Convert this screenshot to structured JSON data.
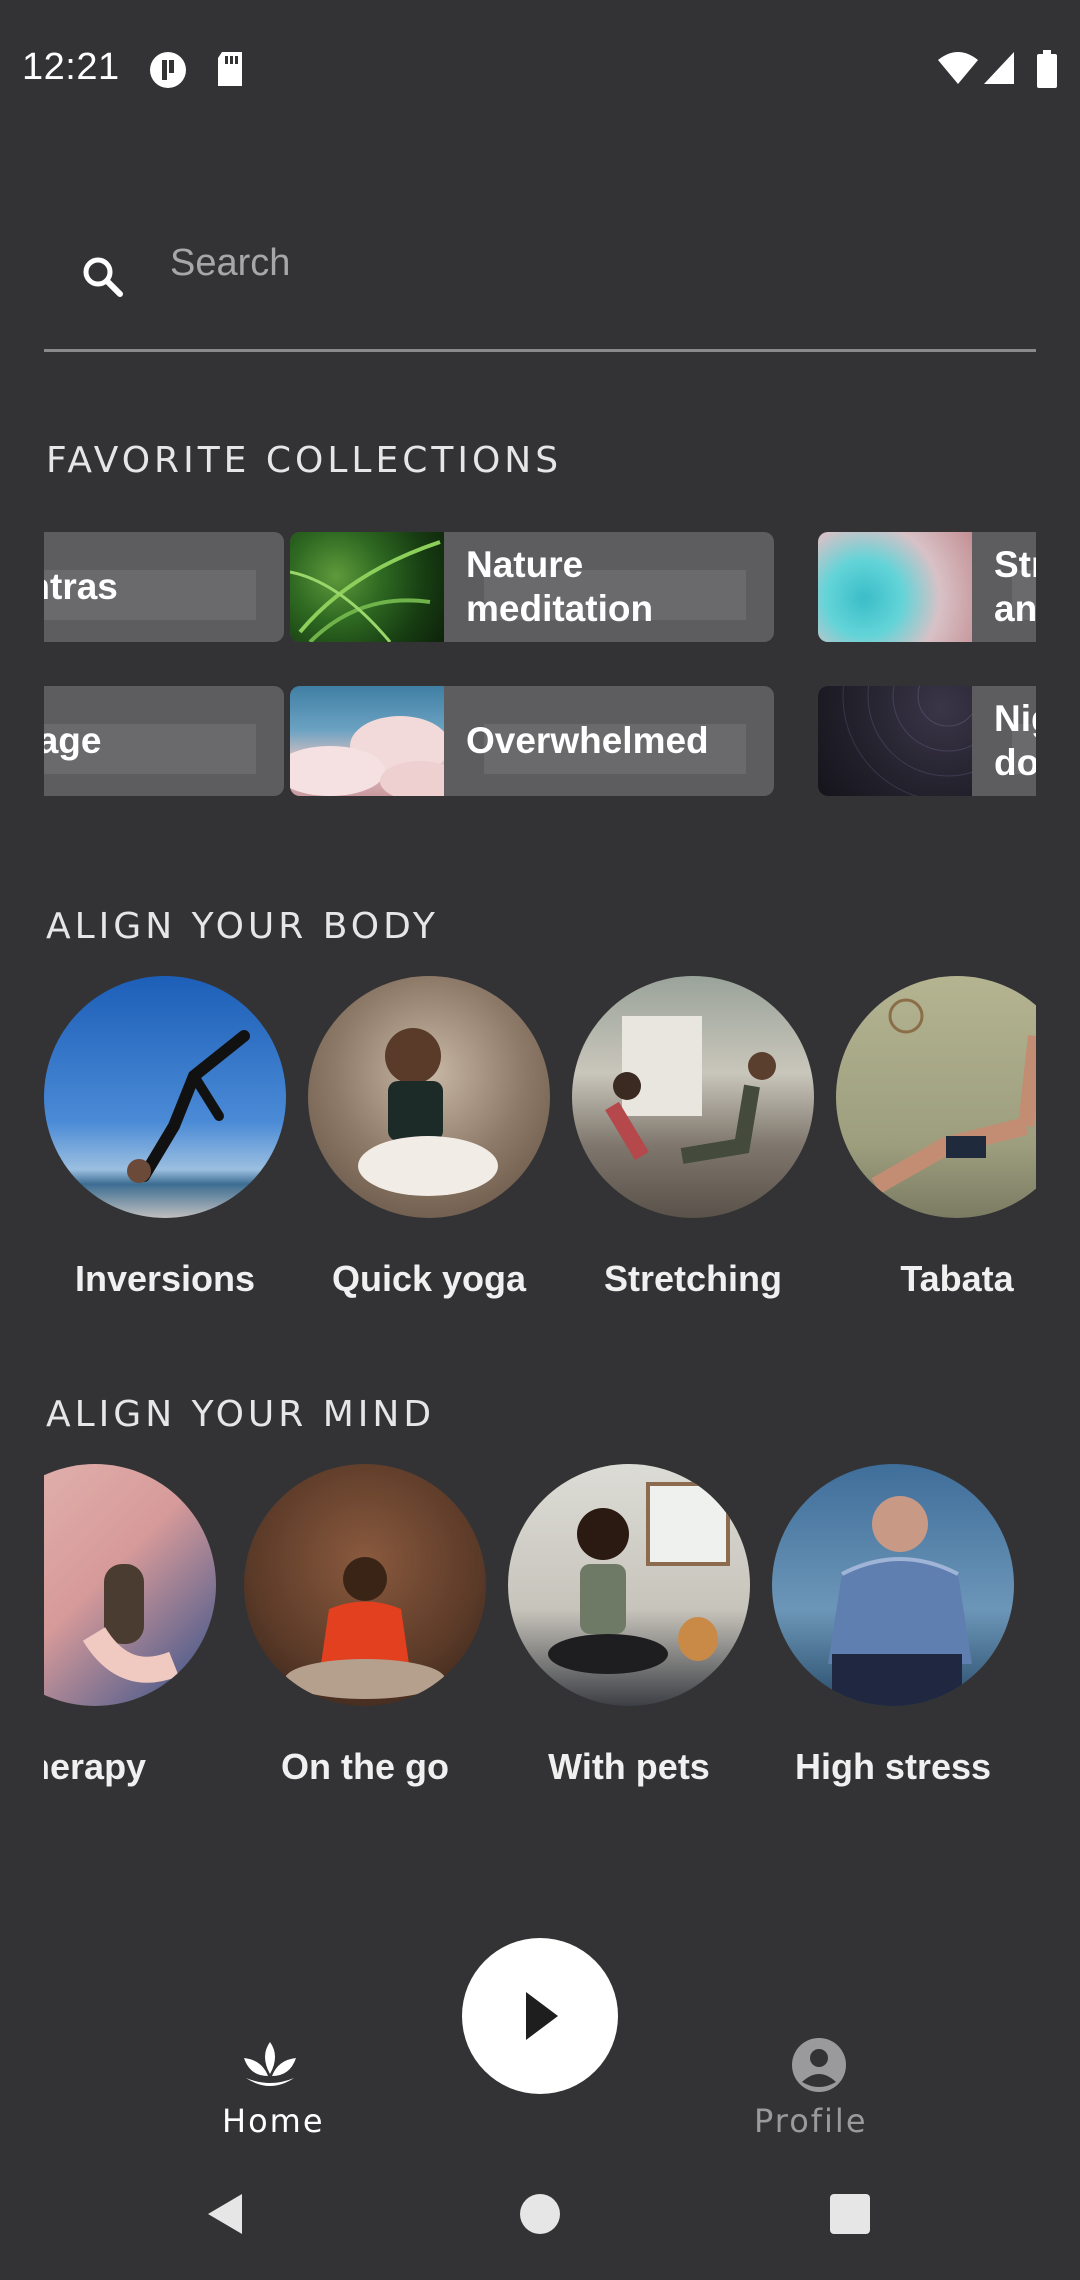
{
  "status_bar": {
    "time": "12:21"
  },
  "search": {
    "placeholder": "Search"
  },
  "favorite_collections": {
    "title": "FAVORITE COLLECTIONS",
    "items": [
      {
        "label": "Mantras"
      },
      {
        "label": "Nature meditation"
      },
      {
        "label": "Str an"
      },
      {
        "label": "assage"
      },
      {
        "label": "Overwhelmed"
      },
      {
        "label": "Nig do"
      }
    ]
  },
  "align_body": {
    "title": "ALIGN YOUR BODY",
    "items": [
      {
        "label": "Inversions"
      },
      {
        "label": "Quick yoga"
      },
      {
        "label": "Stretching"
      },
      {
        "label": "Tabata"
      }
    ]
  },
  "align_mind": {
    "title": "ALIGN YOUR MIND",
    "items": [
      {
        "label": "matherapy"
      },
      {
        "label": "On the go"
      },
      {
        "label": "With pets"
      },
      {
        "label": "High stress"
      }
    ]
  },
  "bottom_nav": {
    "home_label": "Home",
    "profile_label": "Profile"
  },
  "colors": {
    "background": "#333335",
    "card": "#5d5d60",
    "inactive": "#9a9a9c"
  }
}
